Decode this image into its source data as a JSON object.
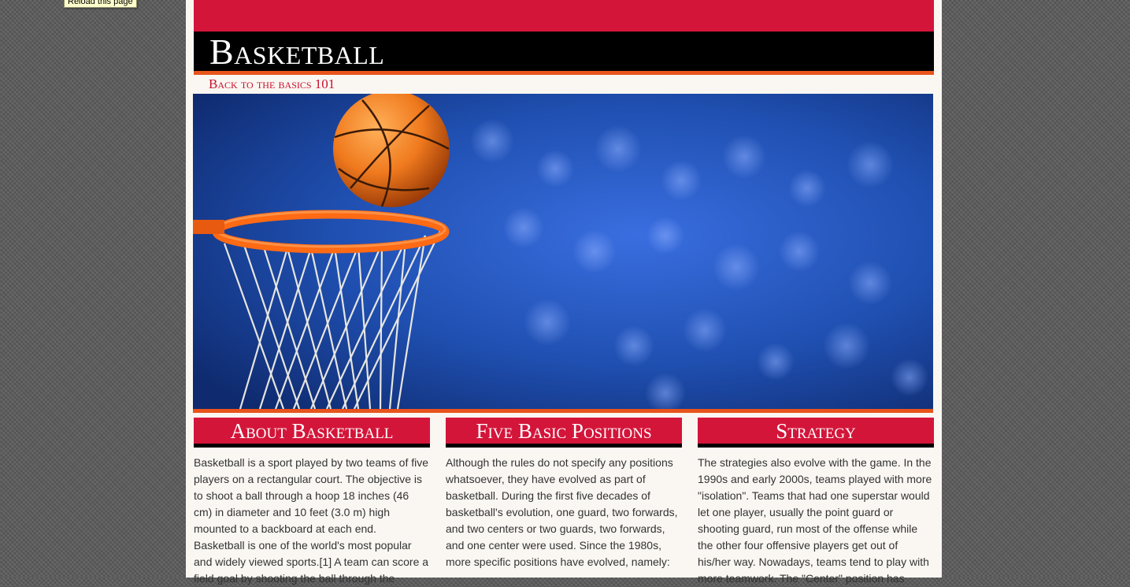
{
  "tooltip": {
    "text": "Reload this page"
  },
  "header": {
    "title": "Basketball",
    "subtitle": "Back to the basics 101"
  },
  "hero": {
    "image": "basketball-hoop-net-ball-arena-photo"
  },
  "sections": [
    {
      "heading": "About Basketball",
      "text": "Basketball is a sport played by two teams of five players on a rectangular court. The objective is to shoot a ball through a hoop 18 inches (46 cm) in diameter and 10 feet (3.0 m) high mounted to a backboard at each end. Basketball is one of the world's most popular and widely viewed sports.[1] A team can score a field goal by shooting the ball through the"
    },
    {
      "heading": "Five Basic Positions",
      "text": "Although the rules do not specify any positions whatsoever, they have evolved as part of basketball. During the first five decades of basketball's evolution, one guard, two forwards, and two centers or two guards, two forwards, and one center were used. Since the 1980s, more specific positions have evolved, namely:"
    },
    {
      "heading": "Strategy",
      "text": "The strategies also evolve with the game. In the 1990s and early 2000s, teams played with more \"isolation\". Teams that had one superstar would let one player, usually the point guard or shooting guard, run most of the offense while the other four offensive players get out of his/her way. Nowadays, teams tend to play with more teamwork. The \"Center\" position has"
    }
  ],
  "colors": {
    "accent_red": "#d4153a",
    "accent_orange": "#e8541c",
    "title_bar": "#000000",
    "page_bg": "#faf7f2",
    "court_blue": "#1f4fb0"
  }
}
